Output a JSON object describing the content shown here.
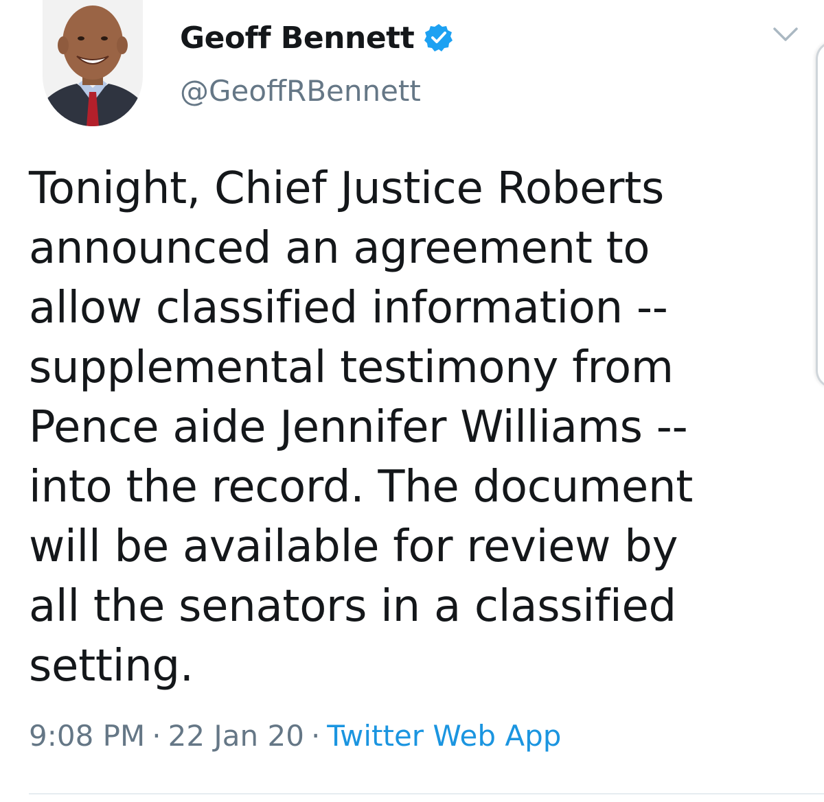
{
  "tweet": {
    "author": {
      "display_name": "Geoff Bennett",
      "handle": "@GeoffRBennett",
      "verified": true
    },
    "text": "Tonight, Chief Justice Roberts\nannounced an agreement to\nallow classified information --\nsupplemental testimony from\nPence aide Jennifer Williams --\ninto the record. The document\nwill be available for review by\nall the senators in a classified\nsetting.",
    "time": "9:08 PM",
    "separator": "·",
    "date": "22 Jan 20",
    "source": "Twitter Web App"
  },
  "icons": {
    "verified": "verified-badge-icon",
    "menu": "chevron-down-icon"
  },
  "colors": {
    "text": "#14171a",
    "secondary": "#657786",
    "accent": "#1b95e0",
    "verified": "#1da1f2"
  }
}
